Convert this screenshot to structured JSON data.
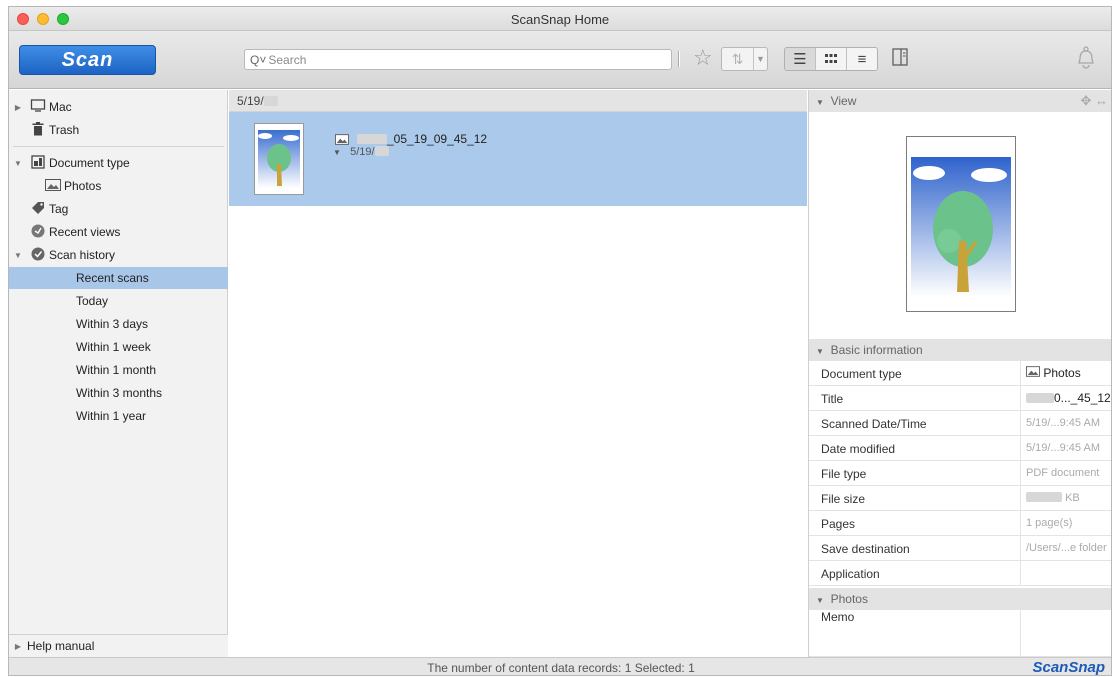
{
  "window": {
    "title": "ScanSnap Home"
  },
  "toolbar": {
    "scan_label": "Scan",
    "search_placeholder": "Search",
    "search_value": ""
  },
  "sidebar": {
    "items": [
      {
        "label": "Mac",
        "icon": "monitor-icon",
        "expander": "collapsed"
      },
      {
        "label": "Trash",
        "icon": "trash-icon"
      },
      {
        "label": "Document type",
        "icon": "document-type-icon",
        "expander": "expanded"
      },
      {
        "label": "Photos",
        "icon": "photo-icon"
      },
      {
        "label": "Tag",
        "icon": "tag-icon"
      },
      {
        "label": "Recent views",
        "icon": "recent-views-icon"
      },
      {
        "label": "Scan history",
        "icon": "scan-history-icon",
        "expander": "expanded"
      },
      {
        "label": "Recent scans",
        "selected": true
      },
      {
        "label": "Today"
      },
      {
        "label": "Within 3 days"
      },
      {
        "label": "Within 1 week"
      },
      {
        "label": "Within 1 month"
      },
      {
        "label": "Within 3 months"
      },
      {
        "label": "Within 1 year"
      }
    ],
    "help_label": "Help manual"
  },
  "content": {
    "group_date": "5/19/",
    "rows": [
      {
        "title_suffix": "_05_19_09_45_12",
        "date": "5/19/",
        "selected": true
      }
    ]
  },
  "right_panel": {
    "view_header": "View",
    "basic_header": "Basic information",
    "info": [
      {
        "key": "Document type",
        "value": "Photos",
        "icon": "photo-icon",
        "dark": true
      },
      {
        "key": "Title",
        "value": "0..._45_12",
        "dark": true
      },
      {
        "key": "Scanned Date/Time",
        "value": "5/19/...9:45 AM"
      },
      {
        "key": "Date modified",
        "value": "5/19/...9:45 AM"
      },
      {
        "key": "File type",
        "value": "PDF document"
      },
      {
        "key": "File size",
        "value": "KB"
      },
      {
        "key": "Pages",
        "value": "1 page(s)"
      },
      {
        "key": "Save destination",
        "value": "/Users/...e folder"
      },
      {
        "key": "Application",
        "value": ""
      }
    ],
    "photos_header": "Photos",
    "memo_label": "Memo"
  },
  "status": {
    "text": "The number of content data records: 1   Selected: 1",
    "brand": "ScanSnap"
  },
  "colors": {
    "accent": "#1d63c4",
    "selection": "#abc9ea",
    "sidebar_selection": "#a7c6e8"
  }
}
